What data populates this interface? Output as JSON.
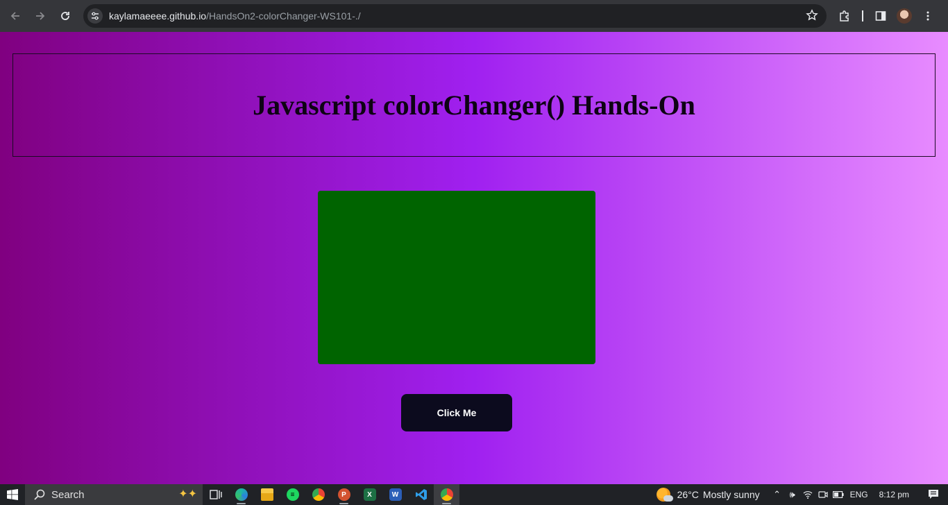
{
  "browser": {
    "url_host": "kaylamaeeee.github.io",
    "url_path": "/HandsOn2-colorChanger-WS101-./"
  },
  "page": {
    "title": "Javascript colorChanger() Hands-On",
    "box_color": "#006400",
    "button_label": "Click Me"
  },
  "taskbar": {
    "search_label": "Search",
    "apps": [
      "task-view",
      "edge",
      "file-explorer",
      "spotify",
      "chrome",
      "powerpoint",
      "excel",
      "word",
      "vscode",
      "chrome-active"
    ],
    "weather_temp": "26°C",
    "weather_text": "Mostly sunny",
    "language": "ENG",
    "time": "8:12 pm"
  },
  "colors": {
    "gradient_start": "#800080",
    "gradient_mid": "#a020f0",
    "gradient_end": "#e88cff",
    "button_bg": "#0c0b1e"
  }
}
